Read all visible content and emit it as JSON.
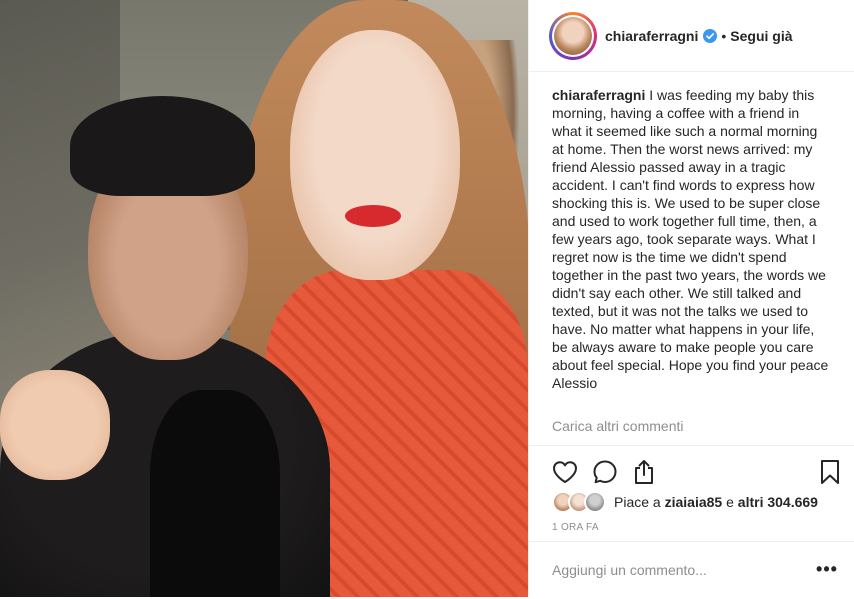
{
  "post": {
    "username": "chiaraferragni",
    "follow_status": "Segui già",
    "separator": "•",
    "caption_user": "chiaraferragni",
    "caption_text": "I was feeding my baby this morning, having a coffee with a friend in what it seemed like such a normal morning at home. Then the worst news arrived: my friend Alessio passed away in a tragic accident. I can't find words to express how shocking this is. We used to be super close and used to work together full time, then, a few years ago, took separate ways. What I regret now is the time we didn't spend together in the past two years, the words we didn't say each other. We still talked and texted, but it was not the talks we used to have. No matter what happens in your life, be always aware to make people you care about feel special. Hope you find your peace Alessio",
    "load_more": "Carica altri commenti",
    "likes_prefix": "Piace a",
    "likes_user": "ziaiaia85",
    "likes_middle": "e",
    "likes_others": "altri 304.669",
    "time_ago": "1 ORA FA",
    "comment_placeholder": "Aggiungi un commento...",
    "options_label": "•••"
  },
  "icons": {
    "like": "heart-icon",
    "comment": "comment-icon",
    "share": "share-icon",
    "save": "bookmark-icon",
    "verified": "verified-badge-icon"
  },
  "colors": {
    "verified": "#3897f0",
    "text": "#262626",
    "muted": "#8e8e8e",
    "border": "#efefef"
  }
}
